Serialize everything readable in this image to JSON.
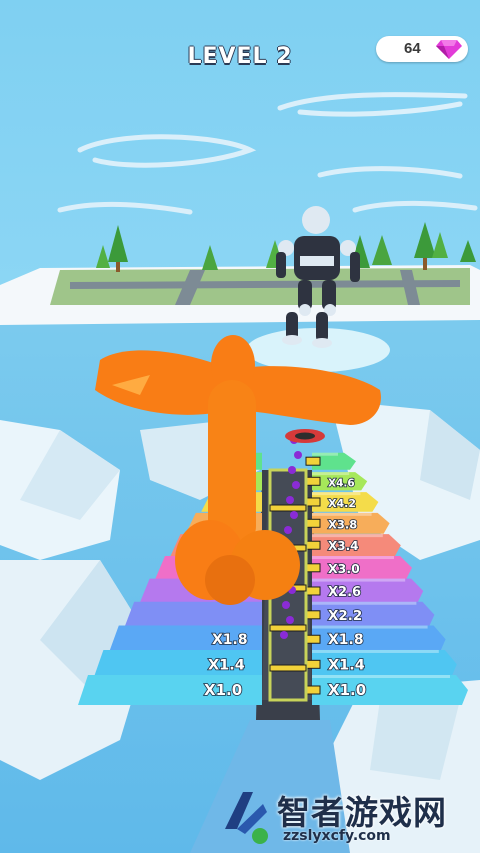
{
  "hud": {
    "level_label": "LEVEL 2",
    "gem_count": "64",
    "gem_icon": "diamond-gem-icon",
    "gem_color": "#e23bd8"
  },
  "track": {
    "left_multipliers": [
      "X1.0",
      "X1.4",
      "X1.8"
    ],
    "right_multipliers": [
      "X1.0",
      "X1.4",
      "X1.8",
      "X2.2",
      "X2.6",
      "X3.0",
      "X3.4",
      "X3.8",
      "X4.2",
      "X4.6"
    ],
    "bar_colors": [
      "#59d3f0",
      "#4fc6f2",
      "#5aa8f5",
      "#7f8ff5",
      "#b579ee",
      "#ef6fc8",
      "#f58a7a",
      "#f7ad5a",
      "#f4dc4a",
      "#a6e85a",
      "#5fe28d"
    ]
  },
  "characters": {
    "player_color": "#f97d15",
    "boss_color": "#2e3340"
  },
  "watermark": {
    "title": "智者游戏网",
    "url": "zzslyxcfy.com"
  }
}
